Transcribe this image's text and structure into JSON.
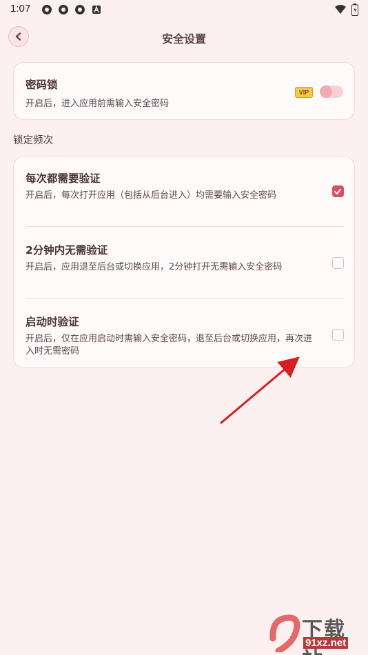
{
  "status_bar": {
    "time": "1:07"
  },
  "header": {
    "title": "安全设置"
  },
  "password_lock": {
    "title": "密码锁",
    "description": "开启后，进入应用前需输入安全密码",
    "vip_badge": "VIP",
    "enabled": false
  },
  "section_label": "锁定频次",
  "options": [
    {
      "title": "每次都需要验证",
      "description": "开启后，每次打开应用（包括从后台进入）均需要输入安全密码",
      "checked": true
    },
    {
      "title": "2分钟内无需验证",
      "description": "开启后，应用退至后台或切换应用，2分钟打开无需输入安全密码",
      "checked": false
    },
    {
      "title": "启动时验证",
      "description": "开启后，仅在应用启动时需输入安全密码，退至后台或切换应用，再次进入时无需密码",
      "checked": false
    }
  ],
  "watermark": {
    "brand": "下载站",
    "domain": "91xz.net"
  },
  "colors": {
    "accent": "#d8525f",
    "background": "#fdf0f0",
    "card": "#fefafa",
    "arrow": "#d42020"
  }
}
